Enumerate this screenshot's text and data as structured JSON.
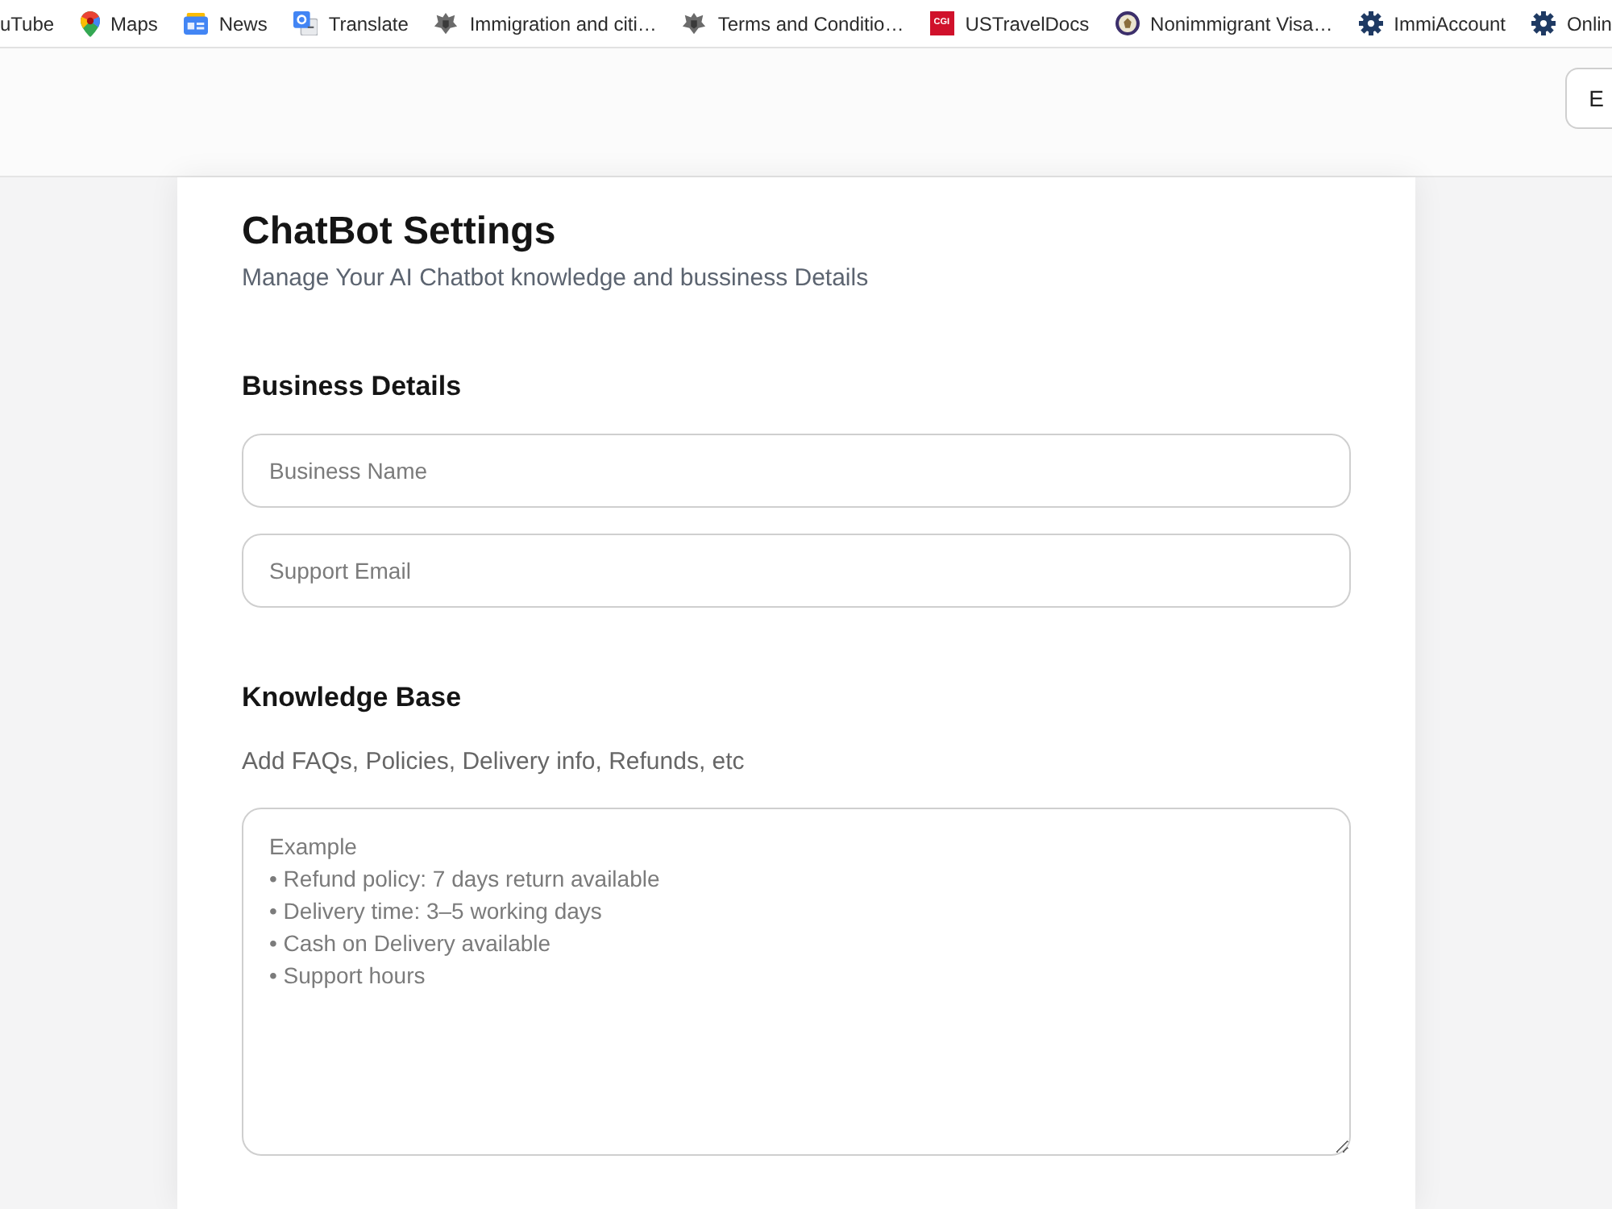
{
  "bookmarks": [
    {
      "label": "uTube",
      "kind": "plain"
    },
    {
      "label": "Maps",
      "kind": "pin"
    },
    {
      "label": "News",
      "kind": "news"
    },
    {
      "label": "Translate",
      "kind": "translate"
    },
    {
      "label": "Immigration and citi…",
      "kind": "crest"
    },
    {
      "label": "Terms and Conditio…",
      "kind": "crest"
    },
    {
      "label": "USTravelDocs",
      "kind": "logo",
      "logo_text": "CGI"
    },
    {
      "label": "Nonimmigrant Visa…",
      "kind": "seal"
    },
    {
      "label": "ImmiAccount",
      "kind": "gear"
    },
    {
      "label": "Onlin",
      "kind": "gear"
    }
  ],
  "header": {
    "button": "E"
  },
  "card": {
    "title": "ChatBot Settings",
    "subtitle": "Manage Your AI Chatbot knowledge and bussiness Details",
    "sections": [
      {
        "kind": "fields",
        "heading": "Business Details",
        "fields": [
          {
            "placeholder": "Business Name"
          },
          {
            "placeholder": "Support Email"
          }
        ]
      },
      {
        "kind": "textarea",
        "heading": "Knowledge Base",
        "hint": "Add FAQs, Policies, Delivery info, Refunds, etc",
        "placeholder": "Example\n• Refund policy: 7 days return available\n• Delivery time: 3–5 working days\n• Cash on Delivery available\n• Support hours"
      }
    ]
  }
}
